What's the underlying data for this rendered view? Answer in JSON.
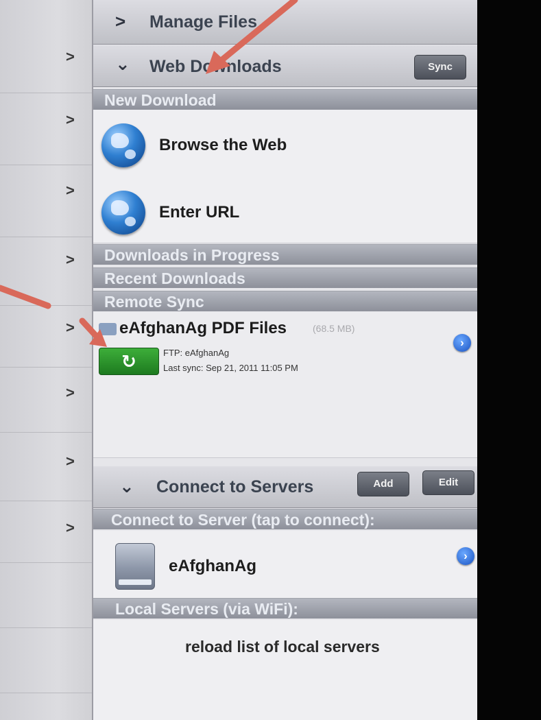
{
  "sidebar": {
    "chevron": ">"
  },
  "manage_files": {
    "caret": ">",
    "title": "Manage Files"
  },
  "web_downloads": {
    "caret": "⌄",
    "title": "Web Downloads",
    "sync_label": "Sync",
    "new_download_header": "New Download",
    "browse_label": "Browse the Web",
    "enter_url_label": "Enter URL",
    "in_progress_header": "Downloads in Progress",
    "recent_header": "Recent Downloads",
    "remote_sync_header": "Remote Sync",
    "remote_item": {
      "name": "eAfghanAg PDF Files",
      "size": "(68.5 MB)",
      "protocol_line": "FTP: eAfghanAg",
      "last_sync_line": "Last sync: Sep 21, 2011 11:05 PM",
      "sync_icon": "↻"
    }
  },
  "connect_servers": {
    "caret": "⌄",
    "title": "Connect to Servers",
    "add_label": "Add",
    "edit_label": "Edit",
    "connect_header": "Connect to Server (tap to connect):",
    "server_name": "eAfghanAg",
    "local_header": "Local Servers (via WiFi):",
    "reload_label": "reload list of local servers"
  },
  "colors": {
    "annotation_arrow": "#d9695a",
    "sync_green": "#2e9a2d",
    "section_gray": "#9a9da6"
  }
}
